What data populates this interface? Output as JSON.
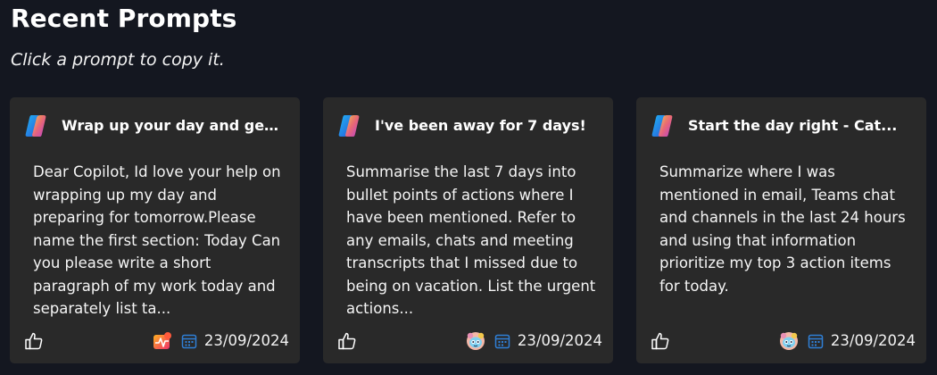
{
  "header": {
    "title": "Recent Prompts",
    "subtitle": "Click a prompt to copy it."
  },
  "colors": {
    "background": "#141720",
    "card": "#292929",
    "calendar_accent": "#2f7fd6"
  },
  "cards": [
    {
      "title": "Wrap up your day and get ...",
      "body": "Dear Copilot, Id love your help on wrapping up my day and preparing for tomorrow.Please name the first section: Today Can you please write a short paragraph of my work today and separately list ta...",
      "date": "23/09/2024",
      "agent_icon": "activity-badge-icon"
    },
    {
      "title": "I've been away for 7 days!",
      "body": "Summarise the last 7 days into bullet points of actions where I have been mentioned. Refer to any emails, chats and meeting transcripts that I missed due to being on vacation. List the urgent actions...",
      "date": "23/09/2024",
      "agent_icon": "bot-avatar-icon"
    },
    {
      "title": "Start the day right - Cat...",
      "body": "Summarize where I was mentioned in email, Teams chat and channels in the last 24 hours and using that information prioritize my top 3 action items for today.",
      "date": "23/09/2024",
      "agent_icon": "bot-avatar-icon"
    }
  ]
}
